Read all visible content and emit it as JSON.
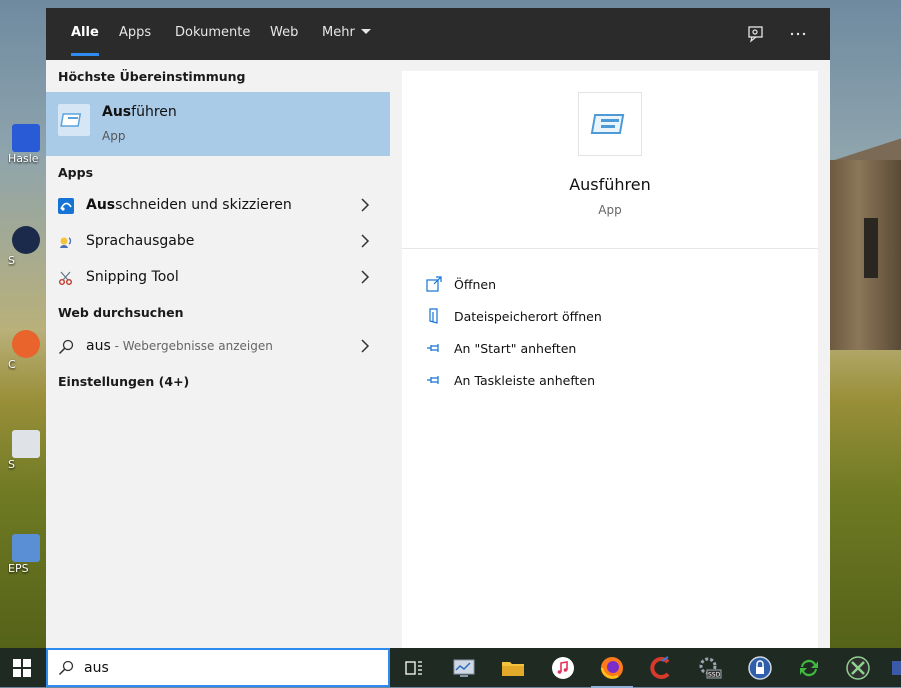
{
  "tabs": [
    {
      "label": "Alle",
      "active": true
    },
    {
      "label": "Apps"
    },
    {
      "label": "Dokumente"
    },
    {
      "label": "Web"
    },
    {
      "label": "Mehr"
    }
  ],
  "toolbar": {
    "feedback_icon": "feedback-icon",
    "more_icon": "more-dots-icon"
  },
  "results": {
    "best_match_heading": "Höchste Übereinstimmung",
    "best_match": {
      "name_bold": "Aus",
      "name_rest": "führen",
      "type": "App"
    },
    "apps_heading": "Apps",
    "apps": [
      {
        "bold": "Aus",
        "rest": "schneiden und skizzieren"
      },
      {
        "bold": "",
        "rest": "Sprachausgabe"
      },
      {
        "bold": "",
        "rest": "Snipping Tool"
      }
    ],
    "web_heading": "Web durchsuchen",
    "web_query": "aus",
    "web_suffix": " - Webergebnisse anzeigen",
    "settings_heading": "Einstellungen (4+)"
  },
  "preview": {
    "title": "Ausführen",
    "subtitle": "App",
    "actions": [
      {
        "label": "Öffnen",
        "icon": "open-icon"
      },
      {
        "label": "Dateispeicherort öffnen",
        "icon": "file-location-icon"
      },
      {
        "label": "An \"Start\" anheften",
        "icon": "pin-icon"
      },
      {
        "label": "An Taskleiste anheften",
        "icon": "pin-icon"
      }
    ]
  },
  "searchbox": {
    "value": "aus"
  },
  "desktop": {
    "labels": [
      "Hasle",
      "S",
      "C",
      "S",
      "EPS"
    ]
  },
  "colors": {
    "accent": "#2e8cf0",
    "selected": "#aacbe8",
    "tabbar": "#2b2b2b"
  }
}
